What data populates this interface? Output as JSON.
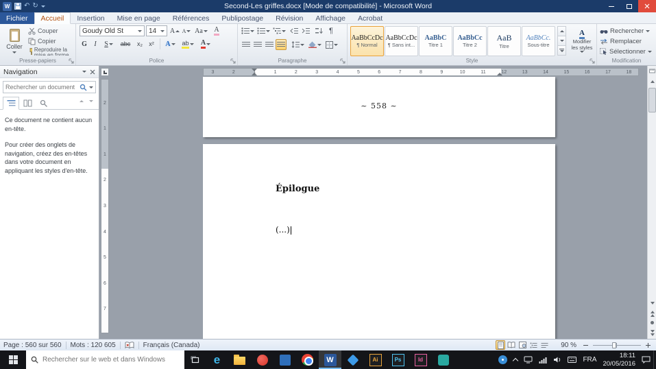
{
  "title_bar": {
    "app_glyph": "W",
    "title": "Second-Les griffes.docx [Mode de compatibilité] - Microsoft Word"
  },
  "ribbon": {
    "file_tab": "Fichier",
    "tabs": [
      "Accueil",
      "Insertion",
      "Mise en page",
      "Références",
      "Publipostage",
      "Révision",
      "Affichage",
      "Acrobat"
    ],
    "clipboard": {
      "label": "Presse-papiers",
      "paste": "Coller",
      "cut": "Couper",
      "copy": "Copier",
      "format_painter": "Reproduire la mise en forme"
    },
    "font": {
      "label": "Police",
      "name": "Goudy Old St",
      "size": "14",
      "grow": "A",
      "shrink": "A",
      "change_case": "Aa",
      "clear": "A",
      "bold": "G",
      "italic": "I",
      "underline": "S",
      "strikethrough": "abc",
      "subscript": "x₂",
      "superscript": "x²",
      "text_effects": "A",
      "highlight": "ab",
      "font_color": "A"
    },
    "paragraph": {
      "label": "Paragraphe",
      "pilcrow": "¶"
    },
    "styles": {
      "label": "Style",
      "gallery": [
        {
          "sample": "AaBbCcDc",
          "name": "¶ Normal"
        },
        {
          "sample": "AaBbCcDc",
          "name": "¶ Sans int..."
        },
        {
          "sample": "AaBbC",
          "name": "Titre 1"
        },
        {
          "sample": "AaBbCc",
          "name": "Titre 2"
        },
        {
          "sample": "AaB",
          "name": "Titre"
        },
        {
          "sample": "AaBbCc.",
          "name": "Sous-titre"
        }
      ],
      "change_styles_icon": "A",
      "change_styles": "Modifier les styles"
    },
    "editing": {
      "label": "Modification",
      "find": "Rechercher",
      "replace": "Remplacer",
      "select": "Sélectionner"
    }
  },
  "navigation_pane": {
    "title": "Navigation",
    "search_placeholder": "Rechercher un document",
    "message_1": "Ce document ne contient aucun en-tête.",
    "message_2": "Pour créer des onglets de navigation, créez des en-têtes dans votre document en appliquant les styles d'en-tête."
  },
  "document": {
    "page_number_marker": "~ 558 ~",
    "heading": "Épilogue",
    "paragraph": "(...)"
  },
  "rulers": {
    "horizontal": [
      "3",
      "2",
      "1",
      "1",
      "2",
      "3",
      "4",
      "5",
      "6",
      "7",
      "8",
      "9",
      "10",
      "11",
      "12",
      "13",
      "14",
      "15",
      "16",
      "17",
      "18"
    ],
    "vertical": [
      "2",
      "1",
      "1",
      "2",
      "3",
      "4",
      "5",
      "6",
      "7"
    ]
  },
  "status_bar": {
    "page_info": "Page : 560 sur 560",
    "word_count": "Mots : 120 605",
    "language": "Français (Canada)",
    "zoom": "90 %"
  },
  "taskbar": {
    "search_placeholder": "Rechercher sur le web et dans Windows",
    "apps": {
      "edge": "e",
      "word": "W",
      "illustrator": "Ai",
      "photoshop": "Ps",
      "indesign": "Id"
    },
    "tray": {
      "language": "FRA",
      "time": "18:11",
      "date": "20/05/2016"
    }
  }
}
